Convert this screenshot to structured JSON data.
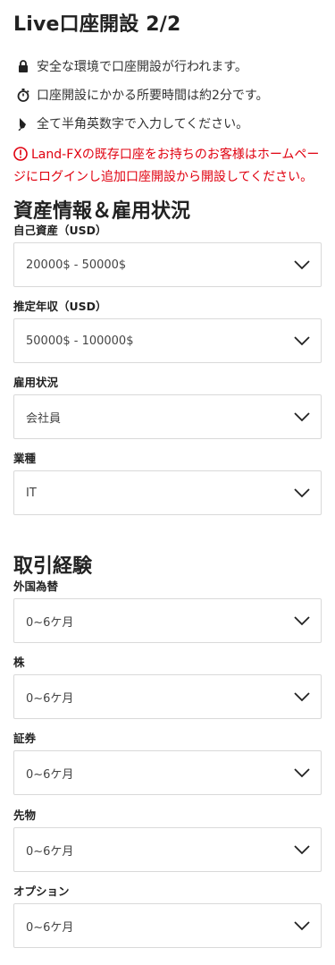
{
  "header": {
    "title": "Live口座開設 2/2"
  },
  "info": [
    {
      "icon": "lock-icon",
      "text": "安全な環境で口座開設が行われます。"
    },
    {
      "icon": "stopwatch-icon",
      "text": "口座開設にかかる所要時間は約2分です。"
    },
    {
      "icon": "pen-icon",
      "text": "全て半角英数字で入力してください。"
    }
  ],
  "notice": {
    "icon": "alert-circle-icon",
    "text": "Land-FXの既存口座をお持ちのお客様はホームページにログインし追加口座開設から開設してください。",
    "color": "#e0000f"
  },
  "assets_section": {
    "title": "資産情報＆雇用状況",
    "fields": [
      {
        "label": "自己資産（USD）",
        "value": "20000$ - 50000$"
      },
      {
        "label": "推定年収（USD）",
        "value": "50000$ - 100000$"
      },
      {
        "label": "雇用状況",
        "value": "会社員"
      },
      {
        "label": "業種",
        "value": "IT"
      }
    ]
  },
  "experience_section": {
    "title": "取引経験",
    "fields": [
      {
        "label": "外国為替",
        "value": "0~6ケ月"
      },
      {
        "label": "株",
        "value": "0~6ケ月"
      },
      {
        "label": "証券",
        "value": "0~6ケ月"
      },
      {
        "label": "先物",
        "value": "0~6ケ月"
      },
      {
        "label": "オプション",
        "value": "0~6ケ月"
      }
    ]
  }
}
